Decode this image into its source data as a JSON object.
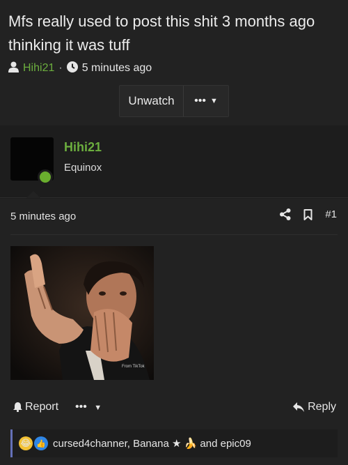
{
  "thread": {
    "title": "Mfs really used to post this shit 3 months ago thinking it was tuff",
    "author": "Hihi21",
    "separator": "·",
    "time": "5 minutes ago",
    "unwatch_label": "Unwatch",
    "more_label": "•••"
  },
  "post": {
    "username": "Hihi21",
    "user_title": "Equinox",
    "time": "5 minutes ago",
    "number": "#1",
    "image_watermark": "From TikTok",
    "report_label": "Report",
    "more_label": "•••",
    "reply_label": "Reply",
    "reactions_text": "cursed4channer, Banana ★ 🍌 and epic09"
  },
  "colors": {
    "accent_green": "#6cae3e",
    "online_dot": "#6aae2e",
    "reaction_bar": "#6470b8"
  },
  "icons": [
    "user-icon",
    "clock-icon",
    "caret-down-icon",
    "share-icon",
    "bookmark-icon",
    "warning-icon",
    "reply-icon",
    "laugh-reaction-icon",
    "like-reaction-icon"
  ]
}
